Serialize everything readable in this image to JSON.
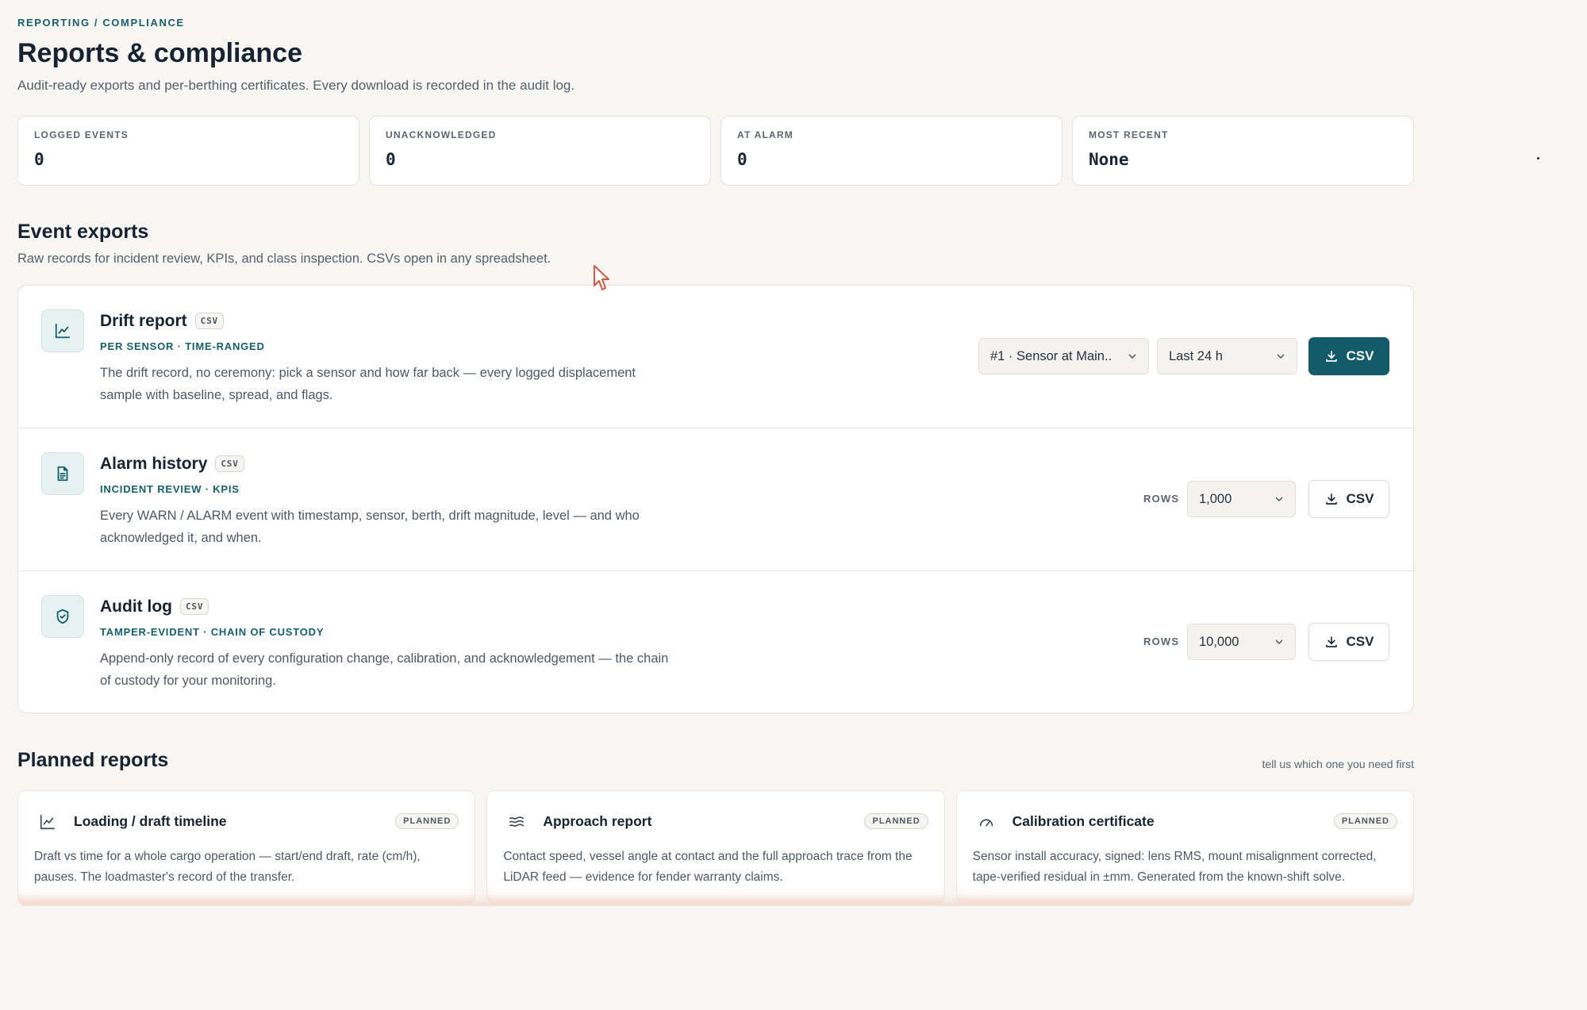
{
  "breadcrumb": "REPORTING / COMPLIANCE",
  "title": "Reports & compliance",
  "subtitle": "Audit-ready exports and per-berthing certificates. Every download is recorded in the audit log.",
  "stats": [
    {
      "label": "LOGGED EVENTS",
      "value": "0"
    },
    {
      "label": "UNACKNOWLEDGED",
      "value": "0"
    },
    {
      "label": "AT ALARM",
      "value": "0"
    },
    {
      "label": "MOST RECENT",
      "value": "None"
    }
  ],
  "event_exports": {
    "title": "Event exports",
    "subtitle": "Raw records for incident review, KPIs, and class inspection. CSVs open in any spreadsheet.",
    "rows": [
      {
        "title": "Drift report",
        "tag": "CSV",
        "meta": "PER SENSOR · TIME-RANGED",
        "desc": "The drift record, no ceremony: pick a sensor and how far back — every logged displacement sample with baseline, spread, and flags.",
        "sensor_select": "#1 · Sensor at Main..",
        "range_select": "Last 24 h",
        "button": "CSV",
        "icon": "chart-line-icon"
      },
      {
        "title": "Alarm history",
        "tag": "CSV",
        "meta": "INCIDENT REVIEW · KPIS",
        "desc": "Every WARN / ALARM event with timestamp, sensor, berth, drift magnitude, level — and who acknowledged it, and when.",
        "rows_label": "ROWS",
        "rows_select": "1,000",
        "button": "CSV",
        "icon": "document-icon"
      },
      {
        "title": "Audit log",
        "tag": "CSV",
        "meta": "TAMPER-EVIDENT · CHAIN OF CUSTODY",
        "desc": "Append-only record of every configuration change, calibration, and acknowledgement — the chain of custody for your monitoring.",
        "rows_label": "ROWS",
        "rows_select": "10,000",
        "button": "CSV",
        "icon": "shield-check-icon"
      }
    ]
  },
  "planned": {
    "title": "Planned reports",
    "hint": "tell us which one you need first",
    "items": [
      {
        "title": "Loading / draft timeline",
        "badge": "PLANNED",
        "desc": "Draft vs time for a whole cargo operation — start/end draft, rate (cm/h), pauses. The loadmaster's record of the transfer.",
        "icon": "chart-line-icon"
      },
      {
        "title": "Approach report",
        "badge": "PLANNED",
        "desc": "Contact speed, vessel angle at contact and the full approach trace from the LiDAR feed — evidence for fender warranty claims.",
        "icon": "waves-icon"
      },
      {
        "title": "Calibration certificate",
        "badge": "PLANNED",
        "desc": "Sensor install accuracy, signed: lens RMS, mount misalignment corrected, tape-verified residual in ±mm. Generated from the known-shift solve.",
        "icon": "gauge-icon"
      }
    ]
  },
  "colors": {
    "accent": "#135b68",
    "accent_text": "#15606b",
    "background": "#f7f6f3"
  }
}
